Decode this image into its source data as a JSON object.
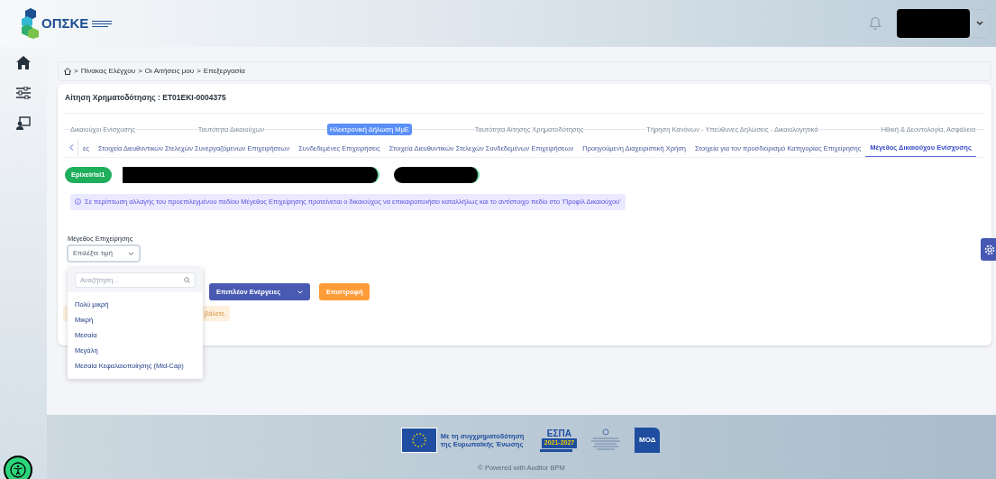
{
  "header": {
    "logo_text": "ΟΠΣΚΕ"
  },
  "breadcrumb": {
    "separator": ">",
    "items": [
      "Πίνακας Ελέγχου",
      "Οι Αιτήσεις μου",
      "Επεξεργασία"
    ]
  },
  "title": "Αίτηση Χρηματοδότησης : ET01EKI-0004375",
  "steps": [
    {
      "label": "Δικαιούχοι Ενίσχυσης",
      "selected": false
    },
    {
      "label": "Ταυτότητα Δικαιούχων",
      "selected": false
    },
    {
      "label": "Ηλεκτρονική Δήλωση ΜμΕ",
      "selected": true
    },
    {
      "label": "Ταυτότητα Αίτησης Χρηματοδότησης",
      "selected": false
    },
    {
      "label": "Τήρηση Κανόνων - Υπεύθυνες Δηλώσεις - Δικαιολογητικά",
      "selected": false
    },
    {
      "label": "Ηθική & Δεοντολογία, Ασφάλεια",
      "selected": false
    }
  ],
  "tabs": [
    {
      "label": "ες",
      "selected": false
    },
    {
      "label": "Στοιχεία Διευθυντικών Στελεχών Συνεργαζόμενων Επιχειρήσεων",
      "selected": false
    },
    {
      "label": "Συνδεδεμένες Επιχειρήσεις",
      "selected": false
    },
    {
      "label": "Στοιχεία Διευθυντικών Στελεχών Συνδεδεμένων Επιχειρήσεων",
      "selected": false
    },
    {
      "label": "Προηγούμενη Διαχειριστική Χρήση",
      "selected": false
    },
    {
      "label": "Στοιχεία για τον προσδιορισμό Κατηγορίας Επιχείρησης",
      "selected": false
    },
    {
      "label": "Μέγεθος Δικαιούχου Ενίσχυσης",
      "selected": true
    }
  ],
  "company_badge": "Epixeirisi1",
  "info": "Σε περίπτωση αλλαγής του προεπιλεγμένου πεδίου Μέγεθος Επιχείρησης προτείνεται ο δικαιούχος να επικαιροποιήσει καταλλήλως και το αντίστοιχο πεδίο στο 'Προφίλ Δικαιούχου'",
  "field": {
    "label": "Μέγεθος Επιχείρησης",
    "placeholder": "Επιλέξτε τιμή",
    "expanded": true,
    "search_placeholder": "Αναζήτηση...",
    "options": [
      "Πολύ μικρή",
      "Μικρή",
      "Μεσαία",
      "Μεγάλη",
      "Μεσαία Κεφαλαιοποίησης (Mid-Cap)"
    ]
  },
  "buttons": [
    {
      "label": "Επιπλέον Ενέργειες",
      "kind": "menu"
    },
    {
      "label": "Επιστροφή",
      "kind": "back"
    }
  ],
  "warning": "βάλετε.",
  "footer": {
    "eu_text": "Με τη συγχρηματοδότηση της Ευρωπαϊκής Ένωσης",
    "espa_title": "ΕΣΠΑ",
    "espa_years": "2021-2027",
    "moda": "ΜΟΔ",
    "copyright": "© Powered with Auditor BPM"
  }
}
